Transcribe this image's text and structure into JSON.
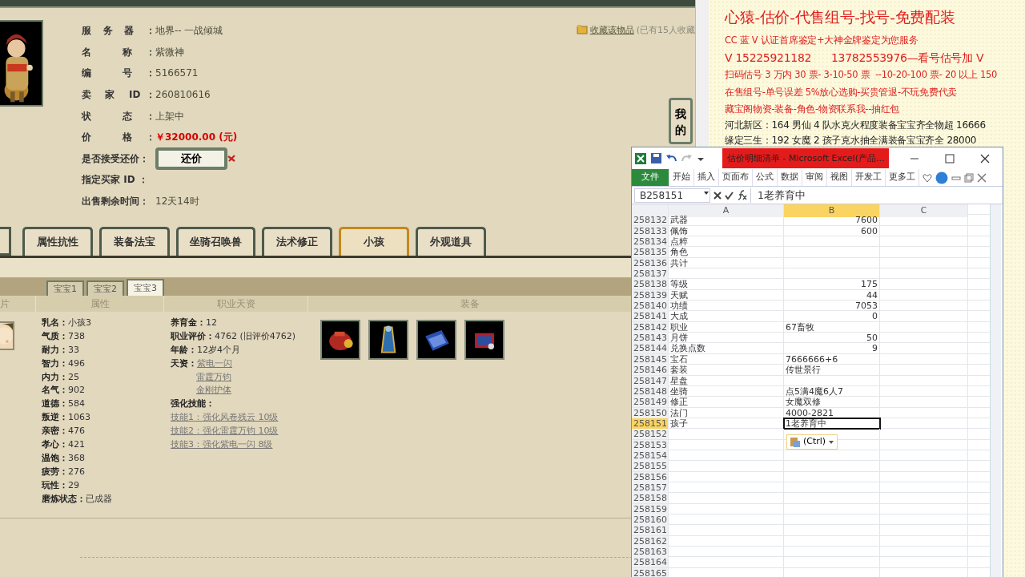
{
  "listing": {
    "fields": [
      {
        "kind": "text",
        "label": "服 务 器 ：",
        "value": "地界-- 一战倾城"
      },
      {
        "kind": "text",
        "label": "名 称：",
        "value": "紫微神"
      },
      {
        "kind": "text",
        "label": "编 号：",
        "value": "5166571"
      },
      {
        "kind": "text",
        "label": "卖 家 ID：",
        "value": "260810616"
      },
      {
        "kind": "text",
        "label": "状 态：",
        "value": "上架中"
      },
      {
        "kind": "price",
        "label": "价 格：",
        "value": "￥32000.00 (元)"
      },
      {
        "kind": "button",
        "label": "是否接受还价：",
        "value": "还价"
      },
      {
        "kind": "text",
        "label": "指定买家 ID ："
      },
      {
        "kind": "text",
        "label": "出售剩余时间：",
        "value": "12天14时"
      }
    ],
    "favorite": {
      "link": "收藏该物品",
      "note": "(已有15人收藏"
    },
    "side_button": "我的"
  },
  "tabs": [
    {
      "label": "属性抗性",
      "selected": false
    },
    {
      "label": "装备法宝",
      "selected": false
    },
    {
      "label": "坐骑召唤兽",
      "selected": false
    },
    {
      "label": "法术修正",
      "selected": false
    },
    {
      "label": "小孩",
      "selected": true
    },
    {
      "label": "外观道具",
      "selected": false
    }
  ],
  "subtabs": [
    {
      "label": "宝宝1",
      "selected": false
    },
    {
      "label": "宝宝2",
      "selected": false
    },
    {
      "label": "宝宝3",
      "selected": true
    }
  ],
  "columns": [
    "片",
    "属性",
    "职业天资",
    "装备"
  ],
  "child": {
    "attributes": [
      {
        "label": "乳名：",
        "value": "小孩3"
      },
      {
        "label": "气质：",
        "value": "738"
      },
      {
        "label": "耐力：",
        "value": "33"
      },
      {
        "label": "智力：",
        "value": "496"
      },
      {
        "label": "内力：",
        "value": "25"
      },
      {
        "label": "名气：",
        "value": "902"
      },
      {
        "label": "道德：",
        "value": "584"
      },
      {
        "label": "叛逆：",
        "value": "1063"
      },
      {
        "label": "亲密：",
        "value": "476"
      },
      {
        "label": "孝心：",
        "value": "421"
      },
      {
        "label": "温饱：",
        "value": "368"
      },
      {
        "label": "疲劳：",
        "value": "276"
      },
      {
        "label": "玩性：",
        "value": "29"
      },
      {
        "label": "磨炼状态：",
        "value": "已成器"
      }
    ],
    "details": [
      {
        "kind": "text",
        "label": "养育金：",
        "value": "12"
      },
      {
        "kind": "text",
        "label": "职业评价：",
        "value": "4762 (旧评价4762)"
      },
      {
        "kind": "text",
        "label": "年龄：",
        "value": "12岁4个月"
      },
      {
        "kind": "links",
        "label": "天资：",
        "links": [
          "紫电一闪",
          "雷霆万钧",
          "金刚护体"
        ]
      },
      {
        "kind": "heading",
        "label": "强化技能："
      },
      {
        "kind": "link",
        "value": "技能1：强化风卷残云 10级"
      },
      {
        "kind": "link",
        "value": "技能2：强化雷霆万钧 10级"
      },
      {
        "kind": "link",
        "value": "技能3：强化紫电一闪 8级"
      }
    ],
    "equipment": [
      {
        "kind": "pouch"
      },
      {
        "kind": "robe"
      },
      {
        "kind": "book"
      },
      {
        "kind": "chest"
      }
    ]
  },
  "document": {
    "lines": [
      {
        "kind": "headline",
        "text": "心猿-估价-代售组号-找号-免费配装"
      },
      {
        "kind": "promo",
        "text": "CC 蓝 V 认证首席鉴定+大神金牌鉴定为您服务"
      },
      {
        "kind": "contact",
        "text": "V 15225921182      13782553976—看号估号加 V"
      },
      {
        "kind": "promo",
        "text": "扫码估号 3 万内 30 票- 3-10-50 票  --10-20-100 票- 20 以上 150"
      },
      {
        "kind": "promo",
        "text": "在售组号-单号误差 5%放心选购-买贵管退-不玩免费代卖"
      },
      {
        "kind": "promo",
        "text": "藏宝阁物资-装备-角色-物资联系我--抽红包"
      },
      {
        "kind": "listing",
        "text": "河北新区：164 男仙 4 队水克火程度装备宝宝齐全物超 16666"
      },
      {
        "kind": "listing",
        "text": "缘定三生：192 女魔 2 孩子克水抽全满装备宝宝齐全 28000"
      }
    ]
  },
  "excel": {
    "title": "估价明细清单 - Microsoft Excel(产品...",
    "ribbon": [
      {
        "label": "文件",
        "kind": "file"
      },
      {
        "label": "开始",
        "kind": "tab"
      },
      {
        "label": "插入",
        "kind": "tab"
      },
      {
        "label": "页面布",
        "kind": "tab"
      },
      {
        "label": "公式",
        "kind": "tab"
      },
      {
        "label": "数据",
        "kind": "tab"
      },
      {
        "label": "审阅",
        "kind": "tab"
      },
      {
        "label": "视图",
        "kind": "tab"
      },
      {
        "label": "开发工",
        "kind": "tab"
      },
      {
        "label": "更多工",
        "kind": "tab"
      }
    ],
    "name_box": "B258151",
    "formula": "1老养育中",
    "columns": [
      {
        "label": "A",
        "selected": false
      },
      {
        "label": "B",
        "selected": true
      },
      {
        "label": "C",
        "selected": false
      }
    ],
    "rows": [
      {
        "number": "258132",
        "a": "武器",
        "b": "7600",
        "kind": "number",
        "selected": false
      },
      {
        "number": "258133",
        "a": "佩饰",
        "b": "600",
        "kind": "number",
        "selected": false
      },
      {
        "number": "258134",
        "a": "点粹",
        "selected": false
      },
      {
        "number": "258135",
        "a": "角色",
        "selected": false
      },
      {
        "number": "258136",
        "a": "共计",
        "selected": false
      },
      {
        "number": "258137",
        "selected": false
      },
      {
        "number": "258138",
        "a": "等级",
        "b": "175",
        "kind": "number",
        "selected": false
      },
      {
        "number": "258139",
        "a": "天赋",
        "b": "44",
        "kind": "number",
        "selected": false
      },
      {
        "number": "258140",
        "a": "功绩",
        "b": "7053",
        "kind": "number",
        "selected": false
      },
      {
        "number": "258141",
        "a": "大成",
        "b": "0",
        "kind": "number",
        "selected": false
      },
      {
        "number": "258142",
        "a": "职业",
        "b": "67畜牧",
        "kind": "text",
        "selected": false
      },
      {
        "number": "258143",
        "a": "月饼",
        "b": "50",
        "kind": "number",
        "selected": false
      },
      {
        "number": "258144",
        "a": "兑换点数",
        "b": "9",
        "kind": "number",
        "selected": false
      },
      {
        "number": "258145",
        "a": "宝石",
        "b": "7666666+6",
        "kind": "text",
        "selected": false
      },
      {
        "number": "258146",
        "a": "套装",
        "b": "传世景行",
        "kind": "text",
        "selected": false
      },
      {
        "number": "258147",
        "a": "星盘",
        "selected": false
      },
      {
        "number": "258148",
        "a": "坐骑",
        "b": "点5满4魔6人7",
        "kind": "text",
        "selected": false
      },
      {
        "number": "258149",
        "a": "修正",
        "b": "女魔双修",
        "kind": "text",
        "selected": false
      },
      {
        "number": "258150",
        "a": "法门",
        "b": "4000-2821",
        "kind": "text",
        "selected": false
      },
      {
        "number": "258151",
        "a": "孩子",
        "b": "1老养育中",
        "kind": "text",
        "selected": true
      },
      {
        "number": "258152",
        "selected": false
      },
      {
        "number": "258153",
        "selected": false
      },
      {
        "number": "258154",
        "selected": false
      },
      {
        "number": "258155",
        "selected": false
      },
      {
        "number": "258156",
        "selected": false
      },
      {
        "number": "258157",
        "selected": false
      },
      {
        "number": "258158",
        "selected": false
      },
      {
        "number": "258159",
        "selected": false
      },
      {
        "number": "258160",
        "selected": false
      },
      {
        "number": "258161",
        "selected": false
      },
      {
        "number": "258162",
        "selected": false
      },
      {
        "number": "258163",
        "selected": false
      },
      {
        "number": "258164",
        "selected": false
      },
      {
        "number": "258165",
        "selected": false
      }
    ],
    "paste_button": "(Ctrl)"
  }
}
